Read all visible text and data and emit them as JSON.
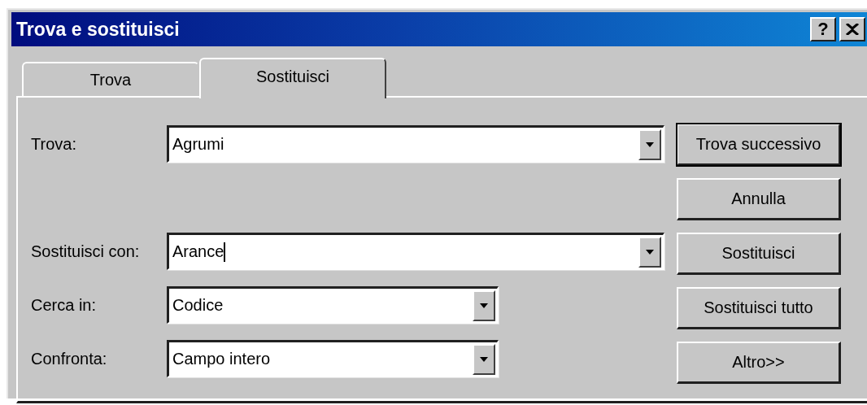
{
  "window": {
    "title": "Trova e sostituisci",
    "help_button": "?"
  },
  "tabs": [
    {
      "label": "Trova",
      "selected": false
    },
    {
      "label": "Sostituisci",
      "selected": true
    }
  ],
  "fields": [
    {
      "label": "Trova:",
      "value": "Agrumi",
      "kind": "editable"
    },
    {
      "label": "Sostituisci con:",
      "value": "Arance",
      "kind": "editable",
      "text_cursor": true
    },
    {
      "label": "Cerca in:",
      "value": "Codice",
      "kind": "list"
    },
    {
      "label": "Confronta:",
      "value": "Campo intero",
      "kind": "list"
    }
  ],
  "buttons": [
    {
      "label": "Trova successivo",
      "default": true
    },
    {
      "label": "Annulla",
      "default": false
    },
    {
      "label": "Sostituisci",
      "default": false
    },
    {
      "label": "Sostituisci tutto",
      "default": false
    },
    {
      "label": "Altro>>",
      "default": false
    }
  ]
}
